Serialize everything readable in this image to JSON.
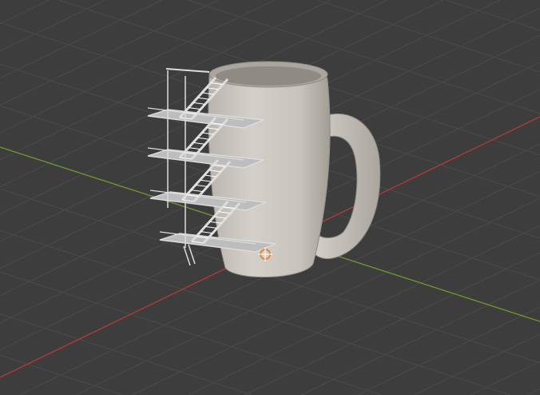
{
  "viewport": {
    "background_color": "#3d3d3d",
    "grid_color": "#4a4a4a",
    "x_axis_color": "#b03a3a",
    "y_axis_color": "#6d9a2f"
  },
  "model": {
    "mug_color": "#cfcac3",
    "mug_shadow_color": "#9d9891",
    "stairs_color": "#dcdcdc",
    "origin_marker_color": "#e08a3a"
  }
}
